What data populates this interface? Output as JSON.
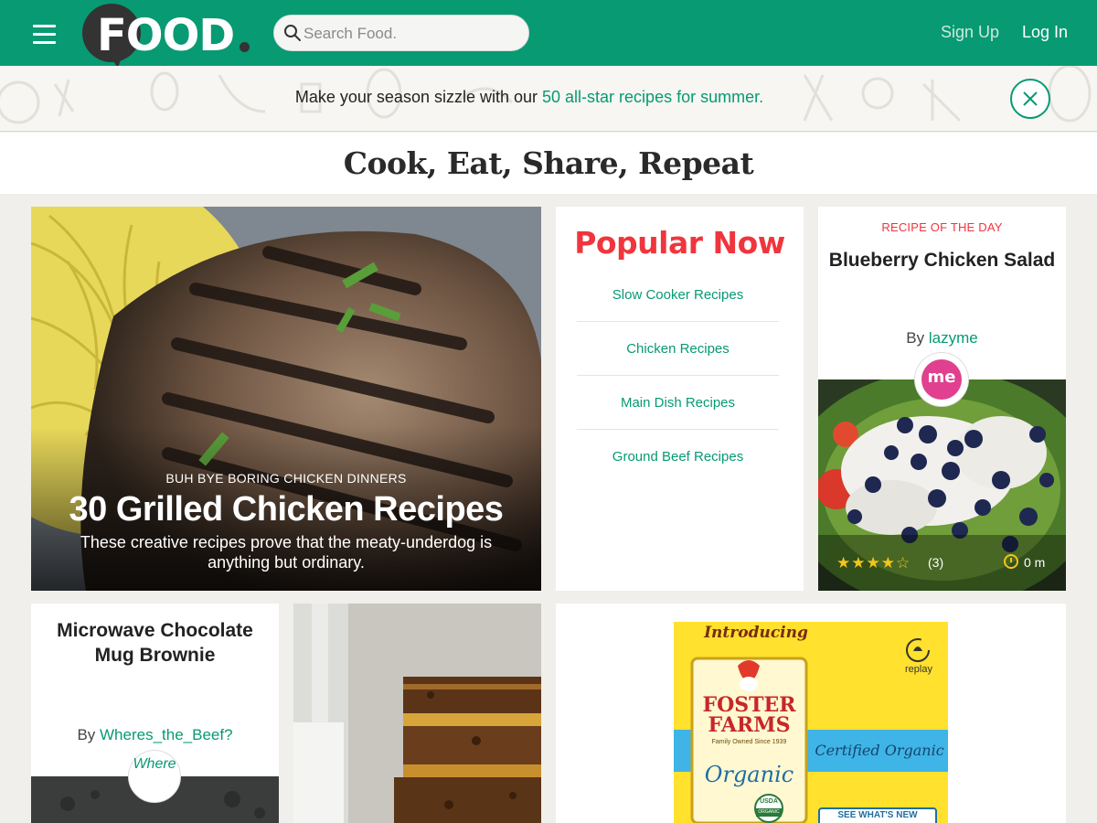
{
  "header": {
    "logo_text": "FOOD",
    "search_placeholder": "Search Food.",
    "signup_label": "Sign Up",
    "login_label": "Log In"
  },
  "banner": {
    "text_prefix": "Make your season sizzle with our ",
    "link_text": "50 all-star recipes for summer."
  },
  "page_title": "Cook, Eat, Share, Repeat",
  "hero": {
    "kicker": "BUH BYE BORING CHICKEN DINNERS",
    "title": "30 Grilled Chicken Recipes",
    "description": "These creative recipes prove that the meaty-underdog is anything but ordinary."
  },
  "popular": {
    "title": "Popular Now",
    "items": [
      {
        "label": "Slow Cooker Recipes"
      },
      {
        "label": "Chicken Recipes"
      },
      {
        "label": "Main Dish Recipes"
      },
      {
        "label": "Ground Beef Recipes"
      }
    ]
  },
  "recipe_of_day": {
    "label": "RECIPE OF THE DAY",
    "title": "Blueberry Chicken Salad",
    "by_prefix": "By ",
    "author": "lazyme",
    "avatar_text": "me",
    "rating": 4,
    "rating_max": 5,
    "rating_count": "(3)",
    "time": "0 m"
  },
  "brownie": {
    "title": "Microwave Chocolate Mug Brownie",
    "by_prefix": "By ",
    "author": "Wheres_the_Beef?",
    "avatar_text": "Where"
  },
  "ad": {
    "introducing": "Introducing",
    "brand_line1": "FOSTER",
    "brand_line2": "FARMS",
    "tagline": "Family Owned Since 1939",
    "organic": "Organic",
    "certified": "Certified Organic",
    "replay": "replay",
    "usda": "USDA",
    "usda_sub": "ORGANIC",
    "cta": "SEE WHAT'S NEW"
  },
  "colors": {
    "brand_green": "#079a73",
    "accent_red": "#f0353d",
    "star_yellow": "#f5c518",
    "ad_yellow": "#ffe12e"
  },
  "icons": [
    "menu-icon",
    "search-icon",
    "close-icon",
    "star-icon",
    "clock-icon",
    "replay-icon"
  ]
}
